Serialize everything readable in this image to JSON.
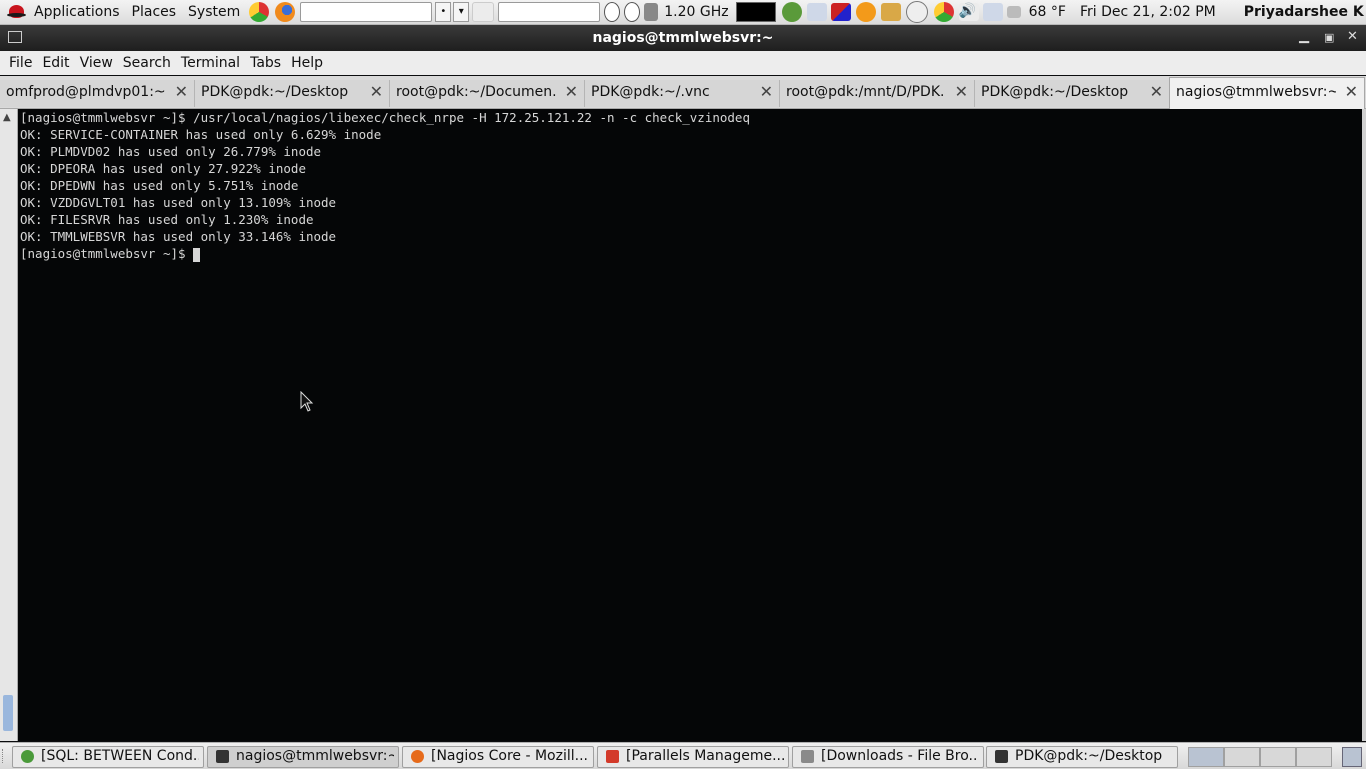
{
  "top_panel": {
    "menu": [
      "Applications",
      "Places",
      "System"
    ],
    "cpu_freq": "1.20 GHz",
    "weather": "68 °F",
    "clock": "Fri Dec 21,  2:02 PM",
    "user": "Priyadarshee K"
  },
  "window": {
    "title": "nagios@tmmlwebsvr:~"
  },
  "menubar": [
    "File",
    "Edit",
    "View",
    "Search",
    "Terminal",
    "Tabs",
    "Help"
  ],
  "tabs": [
    {
      "label": "omfprod@plmdvp01:~..."
    },
    {
      "label": "PDK@pdk:~/Desktop"
    },
    {
      "label": "root@pdk:~/Documen..."
    },
    {
      "label": "PDK@pdk:~/.vnc"
    },
    {
      "label": "root@pdk:/mnt/D/PDK..."
    },
    {
      "label": "PDK@pdk:~/Desktop"
    },
    {
      "label": "nagios@tmmlwebsvr:~"
    }
  ],
  "terminal": {
    "lines": [
      "[nagios@tmmlwebsvr ~]$ /usr/local/nagios/libexec/check_nrpe -H 172.25.121.22 -n -c check_vzinodeq",
      "OK: SERVICE-CONTAINER has used only 6.629% inode",
      "OK: PLMDVD02 has used only 26.779% inode",
      "OK: DPEORA has used only 27.922% inode",
      "OK: DPEDWN has used only 5.751% inode",
      "OK: VZDDGVLT01 has used only 13.109% inode",
      "OK: FILESRVR has used only 1.230% inode",
      "OK: TMMLWEBSVR has used only 33.146% inode",
      "[nagios@tmmlwebsvr ~]$ "
    ]
  },
  "taskbar": [
    {
      "label": "[SQL: BETWEEN Cond...",
      "icon_color": "#4a9a3a"
    },
    {
      "label": "nagios@tmmlwebsvr:~",
      "icon_color": "#333333"
    },
    {
      "label": "[Nagios Core - Mozill...",
      "icon_color": "#e66a1a"
    },
    {
      "label": "[Parallels Manageme...",
      "icon_color": "#d33a2a"
    },
    {
      "label": "[Downloads - File Bro...",
      "icon_color": "#8a8a8a"
    },
    {
      "label": "PDK@pdk:~/Desktop",
      "icon_color": "#333333"
    }
  ],
  "colors": {
    "terminal_bg": "#050607",
    "terminal_fg": "#d6d6d6",
    "titlebar": "#2a2a2a"
  }
}
